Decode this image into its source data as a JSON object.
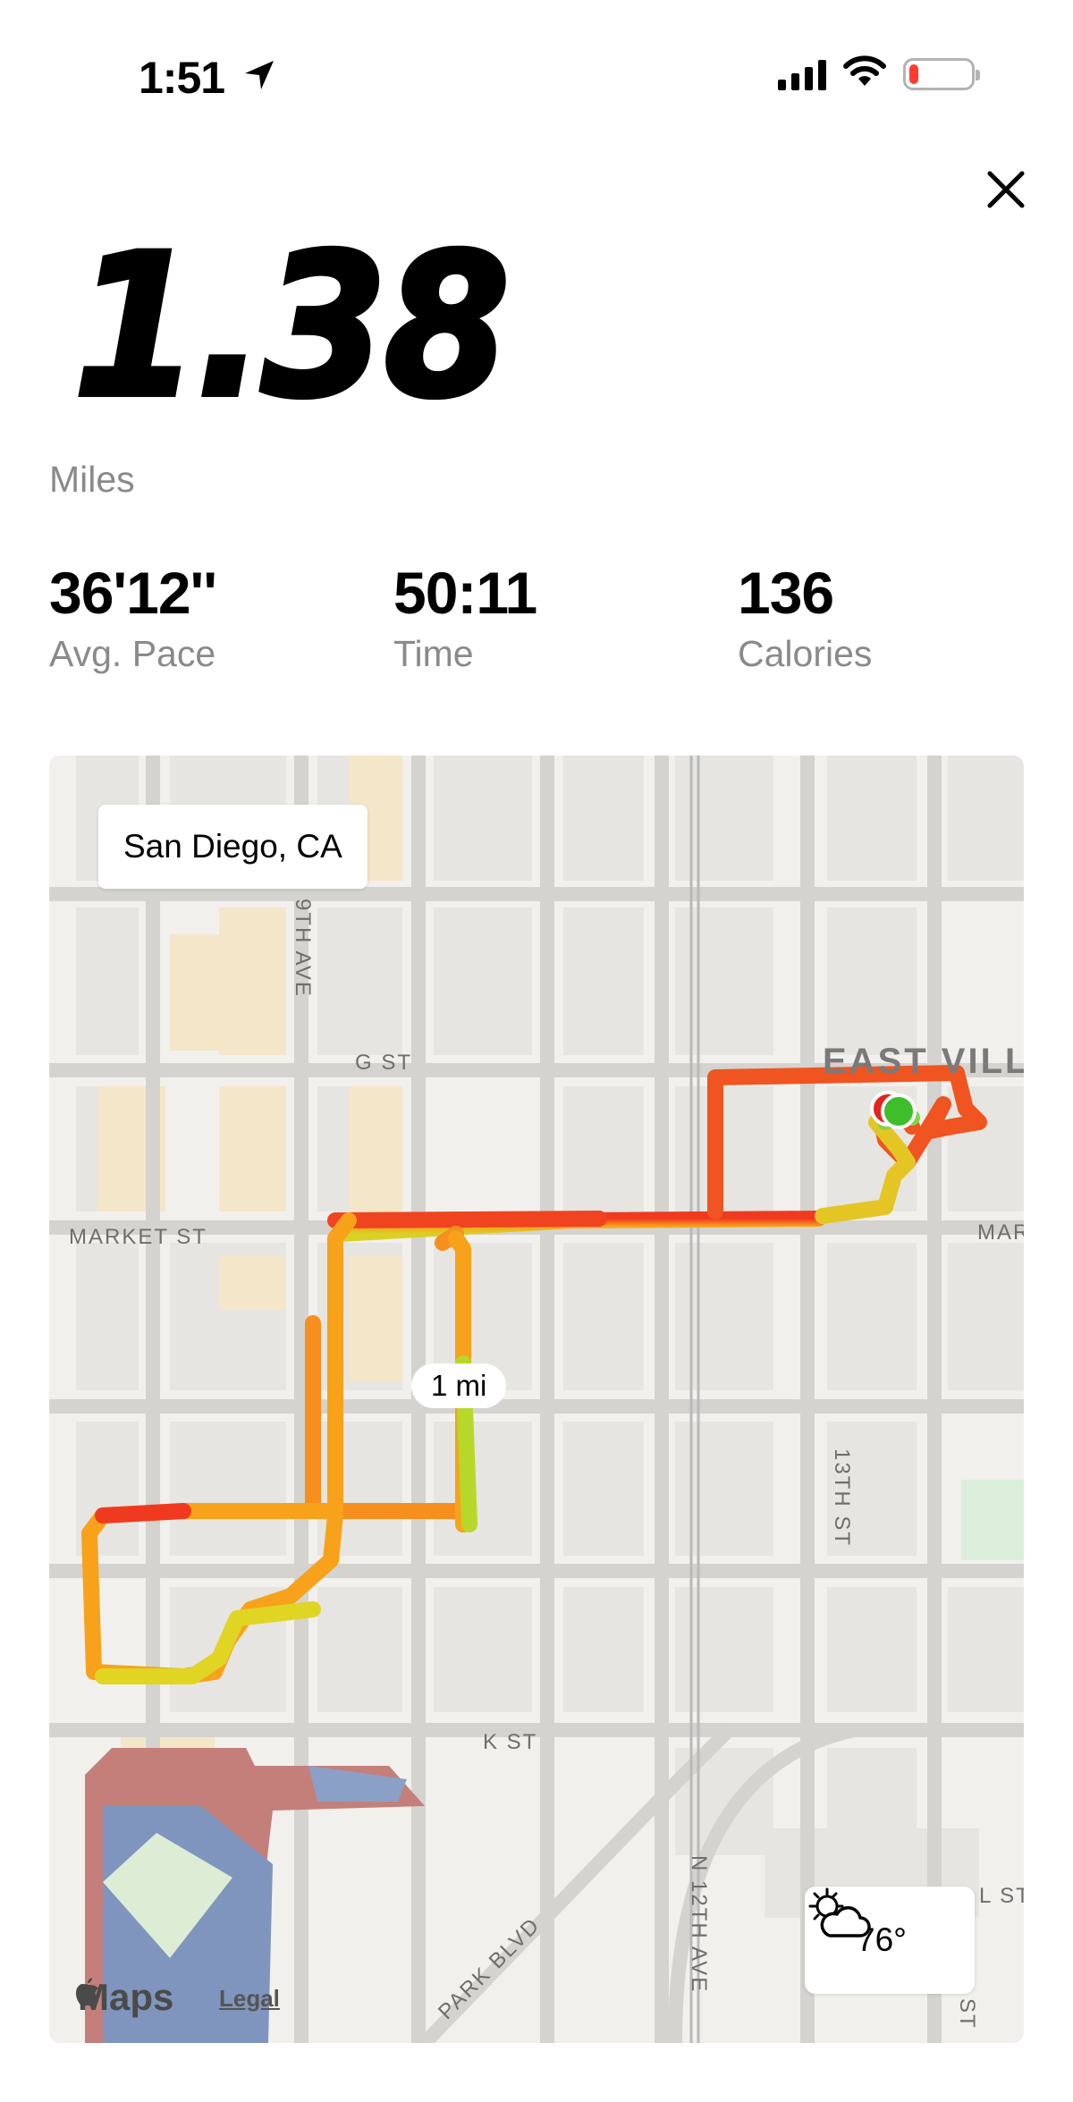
{
  "status_bar": {
    "time": "1:51",
    "battery_level": 0.15
  },
  "summary": {
    "distance": "1.38",
    "distance_unit": "Miles",
    "stats": [
      {
        "value": "36'12''",
        "label": "Avg. Pace"
      },
      {
        "value": "50:11",
        "label": "Time"
      },
      {
        "value": "136",
        "label": "Calories"
      }
    ]
  },
  "map": {
    "location": "San Diego, CA",
    "marker_label": "1 mi",
    "weather_temp": "76°",
    "weather_icon": "partly-cloudy-icon",
    "attribution": "Maps",
    "legal": "Legal",
    "streets": {
      "ninth_ave": "9TH AVE",
      "g_st": "G ST",
      "market_st": "MARKET ST",
      "market_st_right": "MAR",
      "thirteenth_st": "13TH ST",
      "k_st": "K ST",
      "park_blvd": "PARK BLVD",
      "n_twelfth_ave": "N 12TH AVE",
      "l_st": "L ST",
      "st_bottom": "ST",
      "east_village": "EAST VILLAG"
    },
    "colors": {
      "route_slow": "#f03a20",
      "route_mid": "#f7a21a",
      "route_fast": "#c8e023",
      "start": "#3dbe2a",
      "end": "#e5231f"
    }
  }
}
